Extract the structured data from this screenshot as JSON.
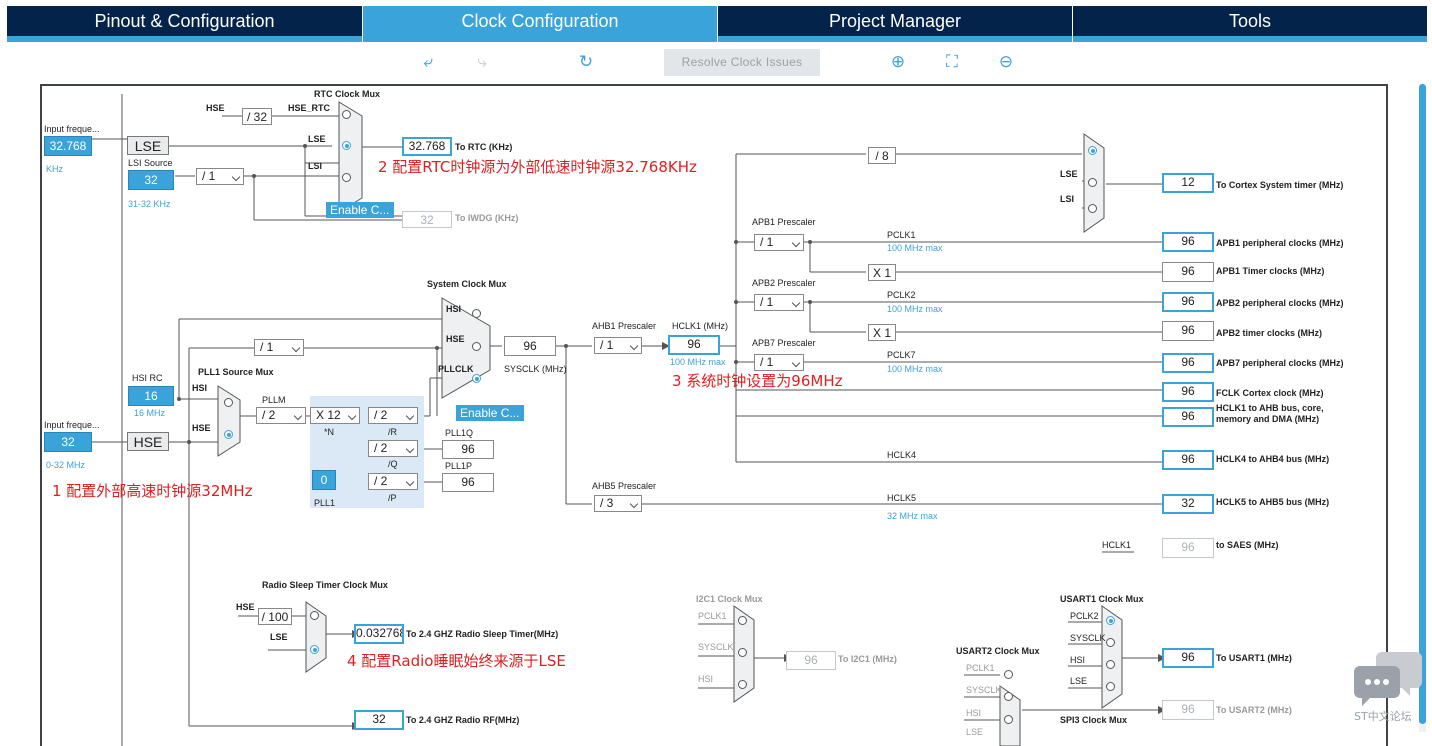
{
  "tabs": [
    {
      "label": "Pinout & Configuration"
    },
    {
      "label": "Clock Configuration"
    },
    {
      "label": "Project Manager"
    },
    {
      "label": "Tools"
    }
  ],
  "toolbar": {
    "resolve_label": "Resolve Clock Issues"
  },
  "colors": {
    "accent": "#3aa3d9",
    "tab_bg": "#03234b",
    "annotation": "#e02020"
  },
  "rtc": {
    "mux_title": "RTC Clock Mux",
    "hse": "HSE",
    "div32": "/ 32",
    "hse_rtc": "HSE_RTC",
    "lse": "LSE",
    "lsi": "LSI",
    "input_freq_label": "Input freque...",
    "input_freq": "32.768",
    "khz": "KHz",
    "lse_box": "LSE",
    "lsi_source": "LSI Source",
    "lsi_value": "32",
    "lsi_range": "31-32 KHz",
    "div1": "/ 1",
    "enable": "Enable C...",
    "rtc_value": "32.768",
    "rtc_label": "To RTC (KHz)",
    "iwdg_value": "32",
    "iwdg_label": "To IWDG (KHz)"
  },
  "annotations": {
    "a1": "1 配置外部高速时钟源32MHz",
    "a2": "2 配置RTC时钟源为外部低速时钟源32.768KHz",
    "a3": "3 系统时钟设置为96MHz",
    "a4": "4 配置Radio睡眠始终来源于LSE"
  },
  "sysclk": {
    "mux_title": "System Clock Mux",
    "hsi": "HSI",
    "hse": "HSE",
    "pllclk": "PLLCLK",
    "value": "96",
    "label": "SYSCLK (MHz)",
    "hsi_rc": "HSI RC",
    "hsi_value": "16",
    "hsi_mhz": "16 MHz",
    "enable": "Enable C...",
    "div1": "/ 1"
  },
  "hse": {
    "input_freq_label": "Input freque...",
    "input_freq": "32",
    "range": "0-32 MHz",
    "box": "HSE"
  },
  "pll": {
    "source_mux": "PLL1 Source Mux",
    "hsi": "HSI",
    "hse": "HSE",
    "pllm": "PLLM",
    "pllm_sel": "/ 2",
    "n_sel": "X 12",
    "n_label": "*N",
    "r_sel": "/ 2",
    "r_label": "/R",
    "q_sel": "/ 2",
    "q_label": "/Q",
    "p_sel": "/ 2",
    "p_label": "/P",
    "pll1q": "PLL1Q",
    "pll1q_value": "96",
    "pll1p": "PLL1P",
    "pll1p_value": "96",
    "pll1": "PLL1",
    "pll1_value": "0"
  },
  "ahb": {
    "ahb1_prescaler": "AHB1 Prescaler",
    "ahb1_sel": "/ 1",
    "hclk1_label": "HCLK1 (MHz)",
    "hclk1_value": "96",
    "hclk1_max": "100 MHz max",
    "ahb5_prescaler": "AHB5 Prescaler",
    "ahb5_sel": "/ 3"
  },
  "apb": {
    "apb1": "APB1 Prescaler",
    "apb1_sel": "/ 1",
    "pclk1": "PCLK1",
    "pclk1_max": "100 MHz max",
    "apb2": "APB2 Prescaler",
    "apb2_sel": "/ 1",
    "pclk2": "PCLK2",
    "pclk2_max": "100 MHz max",
    "apb7": "APB7 Prescaler",
    "apb7_sel": "/ 1",
    "pclk7": "PCLK7",
    "pclk7_max": "100 MHz max",
    "x1a": "X 1",
    "x1b": "X 1"
  },
  "systick": {
    "div8": "/ 8",
    "lse": "LSE",
    "lsi": "LSI",
    "value": "12",
    "label": "To Cortex System timer (MHz)"
  },
  "outputs": [
    {
      "value": "96",
      "label": "APB1 peripheral clocks (MHz)"
    },
    {
      "value": "96",
      "label": "APB1 Timer clocks (MHz)"
    },
    {
      "value": "96",
      "label": "APB2 peripheral clocks (MHz)"
    },
    {
      "value": "96",
      "label": "APB2 timer clocks (MHz)"
    },
    {
      "value": "96",
      "label": "APB7 peripheral clocks (MHz)"
    },
    {
      "value": "96",
      "label": "FCLK Cortex clock (MHz)"
    },
    {
      "value": "96",
      "label": "HCLK1 to AHB bus, core, memory and DMA (MHz)"
    },
    {
      "value": "96",
      "label": "HCLK4 to AHB4 bus (MHz)"
    },
    {
      "value": "32",
      "label": "HCLK5 to AHB5 bus (MHz)"
    }
  ],
  "hclk4": "HCLK4",
  "hclk5": "HCLK5",
  "hclk5_max": "32 MHz max",
  "saes": {
    "hclk1": "HCLK1",
    "value": "96",
    "label": "to SAES (MHz)"
  },
  "radio": {
    "mux_title": "Radio Sleep Timer Clock Mux",
    "hse": "HSE",
    "div100": "/ 100",
    "lse": "LSE",
    "sleep_value": "0.032768",
    "sleep_label": "To 2.4 GHZ Radio Sleep Timer(MHz)",
    "rf_value": "32",
    "rf_label": "To 2.4 GHZ Radio RF(MHz)"
  },
  "i2c1": {
    "mux_title": "I2C1 Clock Mux",
    "pclk1": "PCLK1",
    "sysclk": "SYSCLK",
    "hsi": "HSI",
    "value": "96",
    "label": "To I2C1 (MHz)"
  },
  "usart1": {
    "mux_title": "USART1 Clock Mux",
    "pclk2": "PCLK2",
    "sysclk": "SYSCLK",
    "hsi": "HSI",
    "lse": "LSE",
    "value": "96",
    "label": "To USART1 (MHz)"
  },
  "usart2": {
    "mux_title": "USART2 Clock Mux",
    "pclk1": "PCLK1",
    "sysclk": "SYSCLK",
    "hsi": "HSI",
    "lse": "LSE",
    "value": "96",
    "label": "To USART2 (MHz)"
  },
  "spi3": {
    "mux_title": "SPI3 Clock Mux"
  },
  "watermark": "ST中文论坛"
}
